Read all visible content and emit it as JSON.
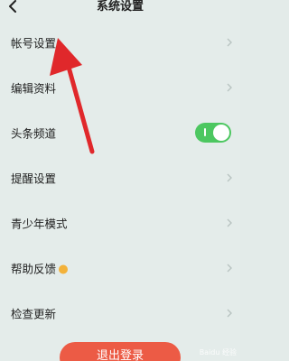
{
  "nav": {
    "title": "系统设置",
    "back_icon": "chevron-left-icon"
  },
  "settings": [
    {
      "label": "帐号设置",
      "value": "",
      "control": "chevron"
    },
    {
      "label": "编辑资料",
      "value": "",
      "control": "chevron"
    },
    {
      "label": "头条频道",
      "value": "",
      "control": "toggle",
      "toggle_on": true
    },
    {
      "label": "提醒设置",
      "value": "",
      "control": "chevron"
    },
    {
      "label": "青少年模式",
      "value": "",
      "control": "chevron"
    },
    {
      "label": "帮助反馈",
      "value": "",
      "control": "chevron"
    },
    {
      "label": "检查更新",
      "value": "",
      "control": "chevron"
    }
  ],
  "logout_label": "退出登录",
  "watermark": "Baidu 经验",
  "colors": {
    "background": "#e4ecea",
    "toggle_on": "#4cc760",
    "logout_button": "#ec5b45",
    "annotation_arrow": "#e0282b"
  }
}
